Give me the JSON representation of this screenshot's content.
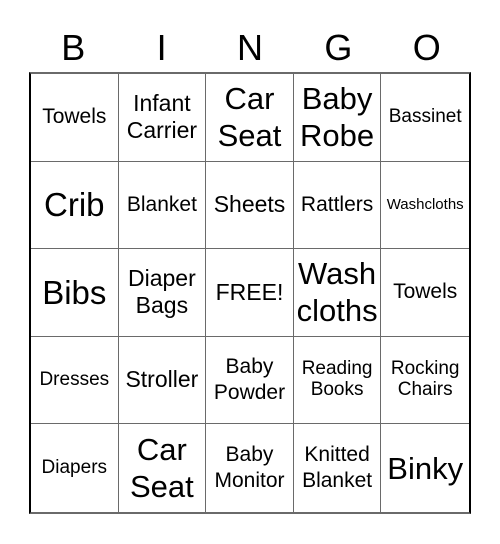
{
  "header": {
    "letters": [
      "B",
      "I",
      "N",
      "G",
      "O"
    ]
  },
  "cells": [
    {
      "text": "Towels",
      "size": "s-n"
    },
    {
      "text": "Infant Carrier",
      "size": "s-m"
    },
    {
      "text": "Car Seat",
      "size": "s-l"
    },
    {
      "text": "Baby Robe",
      "size": "s-l"
    },
    {
      "text": "Bassinet",
      "size": "s-s"
    },
    {
      "text": "Crib",
      "size": "s-xl"
    },
    {
      "text": "Blanket",
      "size": "s-n"
    },
    {
      "text": "Sheets",
      "size": "s-m"
    },
    {
      "text": "Rattlers",
      "size": "s-n"
    },
    {
      "text": "Washcloths",
      "size": "s-xs"
    },
    {
      "text": "Bibs",
      "size": "s-xl"
    },
    {
      "text": "Diaper Bags",
      "size": "s-m"
    },
    {
      "text": "FREE!",
      "size": "s-m"
    },
    {
      "text": "Wash cloths",
      "size": "s-l"
    },
    {
      "text": "Towels",
      "size": "s-n"
    },
    {
      "text": "Dresses",
      "size": "s-s"
    },
    {
      "text": "Stroller",
      "size": "s-m"
    },
    {
      "text": "Baby Powder",
      "size": "s-n"
    },
    {
      "text": "Reading Books",
      "size": "s-s"
    },
    {
      "text": "Rocking Chairs",
      "size": "s-s"
    },
    {
      "text": "Diapers",
      "size": "s-s"
    },
    {
      "text": "Car Seat",
      "size": "s-l"
    },
    {
      "text": "Baby Monitor",
      "size": "s-n"
    },
    {
      "text": "Knitted Blanket",
      "size": "s-n"
    },
    {
      "text": "Binky",
      "size": "s-l"
    }
  ]
}
